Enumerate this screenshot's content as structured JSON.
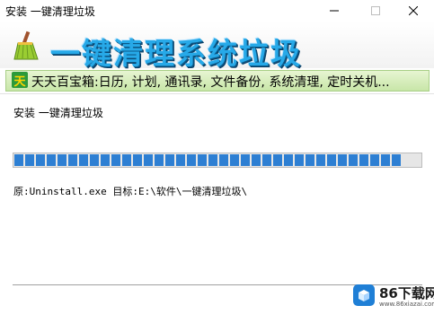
{
  "window": {
    "title": "安装 一键清理垃圾",
    "minimize_icon": "minimize-icon",
    "maximize_icon": "maximize-icon",
    "close_icon": "close-icon"
  },
  "banner": {
    "logo_icon": "broom-icon",
    "title": "一键清理系统垃圾"
  },
  "ad": {
    "badge_text": "天",
    "text": "天天百宝箱:日历, 计划, 通讯录, 文件备份, 系统清理, 定时关机..."
  },
  "install": {
    "status_label": "安装 一键清理垃圾",
    "progress_fraction": 0.955,
    "detail": "原:Uninstall.exe 目标:E:\\软件\\一键清理垃圾\\"
  },
  "watermark": {
    "text": "86下载网",
    "subtext": "www.86xiazai.com"
  },
  "colors": {
    "banner_title": "#27a9e8",
    "progress_fill": "#2d7fd3",
    "ad_background": "#d6edbd"
  }
}
